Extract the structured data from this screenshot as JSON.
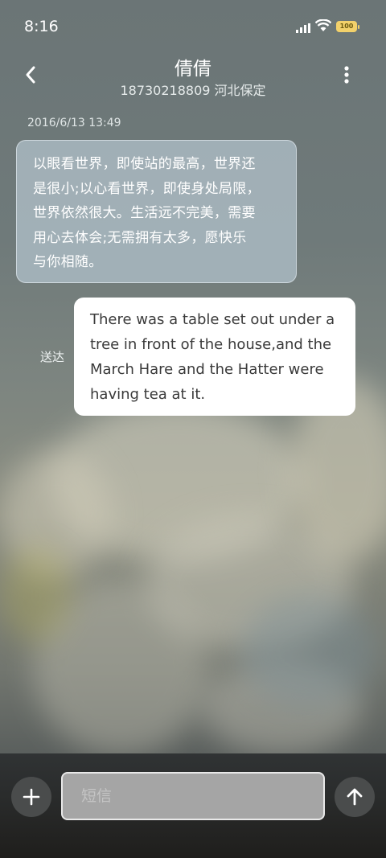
{
  "status_bar": {
    "time": "8:16",
    "signal_icon": "cellular-signal-icon",
    "wifi_icon": "wifi-icon",
    "battery_level": "100",
    "battery_color": "#f2d16b"
  },
  "header": {
    "back_icon": "chevron-left-icon",
    "contact_name": "倩倩",
    "contact_detail": "18730218809 河北保定",
    "more_icon": "vertical-ellipsis-icon"
  },
  "messages": [
    {
      "direction": "incoming",
      "timestamp": "2016/6/13 13:49",
      "lines": [
        "以眼看世界，即使站的最高，世界还",
        "是很小;以心看世界，即使身处局限，",
        "世界依然很大。生活远不完美，需要",
        "用心去体会;无需拥有太多，愿快乐",
        "与你相随。"
      ]
    },
    {
      "direction": "outgoing",
      "status": "送达",
      "lines": [
        "There was a table set out under a",
        "tree in front of the house,and the",
        "March Hare and the Hatter were",
        "having tea at it."
      ]
    }
  ],
  "composer": {
    "add_icon": "plus-icon",
    "placeholder": "短信",
    "value": "",
    "send_icon": "arrow-up-icon"
  }
}
